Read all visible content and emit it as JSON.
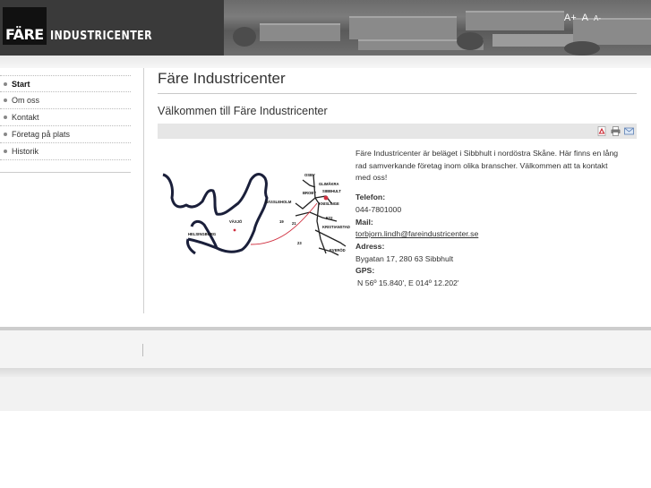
{
  "header": {
    "logo_mark": "FÄRE",
    "logo_text": "INDUSTRICENTER",
    "font_size": {
      "increase": "A+",
      "normal": "A",
      "decrease": "A-"
    }
  },
  "sidebar": {
    "items": [
      {
        "label": "Start",
        "active": true
      },
      {
        "label": "Om oss",
        "active": false
      },
      {
        "label": "Kontakt",
        "active": false
      },
      {
        "label": "Företag på plats",
        "active": false
      },
      {
        "label": "Historik",
        "active": false
      }
    ]
  },
  "main": {
    "title": "Färe Industricenter",
    "subtitle": "Välkommen till Färe Industricenter",
    "toolbar": {
      "pdf_icon": "pdf-icon",
      "print_icon": "print-icon",
      "email_icon": "email-icon"
    },
    "intro": "Färe Industricenter är beläget i Sibbhult i nordöstra Skåne. Här finns en lång rad samverkande företag inom olika branscher. Välkommen att ta kontakt med oss!",
    "phone_label": "Telefon:",
    "phone": "044-7801000",
    "mail_label": "Mail:",
    "mail": "torbjorn.lindh@fareindustricenter.se",
    "address_label": "Adress:",
    "address": "Bygatan 17, 280 63 Sibbhult",
    "gps_label": "GPS:",
    "gps": "N 56º 15.840',  E 014º 12.202'"
  },
  "map": {
    "labels": {
      "osby": "OSBY",
      "glimakra": "GLIMÅKRA",
      "broby": "BROBY",
      "sibbhult": "SIBBHULT",
      "hassleholm": "HÄSSLEHOLM",
      "knislinge": "KNISLINGE",
      "kristianstad": "KRISTIANSTAD",
      "vaxjo": "VÄXJÖ",
      "helsingborg": "HELSINGBORG",
      "everod": "EVERÖD",
      "e22": "E22",
      "r19": "19",
      "r21": "21",
      "r23": "23"
    },
    "colors": {
      "coast": "#1a1f3a",
      "route": "#d03040",
      "road": "#222222"
    }
  }
}
